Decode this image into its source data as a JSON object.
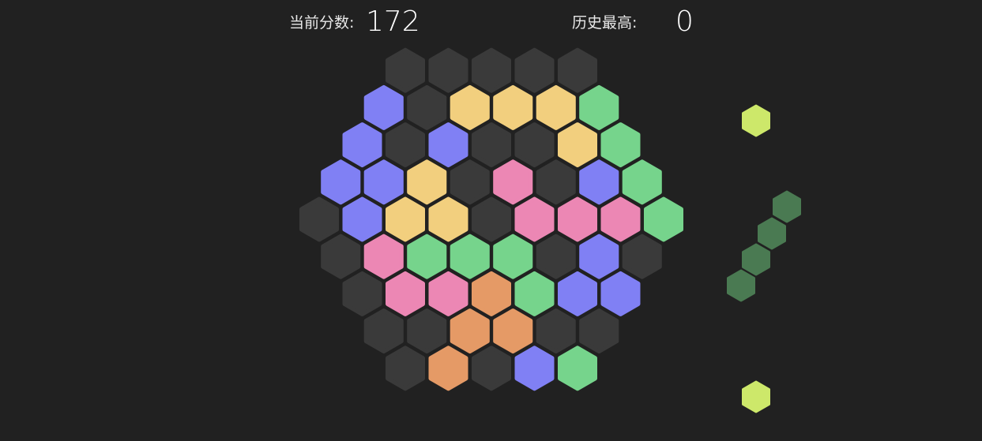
{
  "hud": {
    "score_label": "当前分数:",
    "score": "172",
    "best_label": "历史最高:",
    "best": "0"
  },
  "palette": {
    "empty": "#3a3a3a",
    "blue": "#8080f4",
    "yellow": "#f2cf7e",
    "green": "#76d48c",
    "pink": "#ec87b4",
    "orange": "#e59a66",
    "lime": "#cde86a",
    "dark-green": "#4a7a52"
  },
  "board": {
    "rows": [
      [
        "empty",
        "empty",
        "empty",
        "empty",
        "empty"
      ],
      [
        "blue",
        "empty",
        "yellow",
        "yellow",
        "yellow",
        "green"
      ],
      [
        "blue",
        "empty",
        "blue",
        "empty",
        "empty",
        "yellow",
        "green"
      ],
      [
        "blue",
        "blue",
        "yellow",
        "empty",
        "pink",
        "empty",
        "blue",
        "green"
      ],
      [
        "empty",
        "blue",
        "yellow",
        "yellow",
        "empty",
        "pink",
        "pink",
        "pink",
        "green"
      ],
      [
        "empty",
        "pink",
        "green",
        "green",
        "green",
        "empty",
        "blue",
        "empty"
      ],
      [
        "empty",
        "pink",
        "pink",
        "orange",
        "green",
        "blue",
        "blue"
      ],
      [
        "empty",
        "empty",
        "orange",
        "orange",
        "empty",
        "empty"
      ],
      [
        "empty",
        "orange",
        "empty",
        "blue",
        "green"
      ]
    ]
  },
  "pieces": [
    {
      "name": "piece-single-top",
      "color": "lime",
      "cells": 1
    },
    {
      "name": "piece-diagonal-four",
      "color": "dark-green",
      "cells": 4
    },
    {
      "name": "piece-single-bottom",
      "color": "lime",
      "cells": 1
    }
  ]
}
